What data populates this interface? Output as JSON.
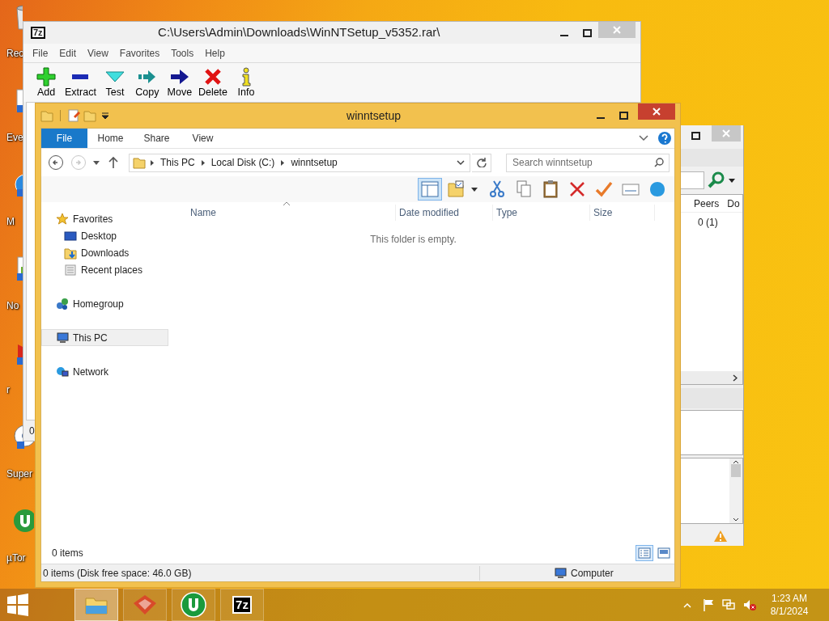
{
  "desktop_icons": [
    {
      "label": "Rec",
      "kind": "bin"
    },
    {
      "label": "Eve",
      "kind": "document"
    },
    {
      "label": "M",
      "kind": "globe"
    },
    {
      "label": "No",
      "kind": "notepad"
    },
    {
      "label": "r",
      "kind": "video"
    },
    {
      "label": "Super",
      "kind": "disc"
    },
    {
      "label": "µTor",
      "kind": "torrent"
    }
  ],
  "archive_window": {
    "logo": "7z",
    "title": "C:\\Users\\Admin\\Downloads\\WinNTSetup_v5352.rar\\",
    "menu": [
      "File",
      "Edit",
      "View",
      "Favorites",
      "Tools",
      "Help"
    ],
    "toolbar": [
      {
        "label": "Add",
        "kind": "add"
      },
      {
        "label": "Extract",
        "kind": "extract"
      },
      {
        "label": "Test",
        "kind": "test"
      },
      {
        "label": "Copy",
        "kind": "copy"
      },
      {
        "label": "Move",
        "kind": "move"
      },
      {
        "label": "Delete",
        "kind": "delete"
      },
      {
        "label": "Info",
        "kind": "info"
      }
    ],
    "status": "0"
  },
  "torrent_window": {
    "columns": [
      "Peers",
      "Do"
    ],
    "rows": [
      {
        "peers": "0 (1)"
      }
    ]
  },
  "explorer": {
    "title": "winntsetup",
    "ribbon_tabs": [
      {
        "label": "File",
        "kind": "file"
      },
      {
        "label": "Home",
        "kind": "tab"
      },
      {
        "label": "Share",
        "kind": "tab"
      },
      {
        "label": "View",
        "kind": "tab"
      }
    ],
    "nav_buttons": [
      {
        "kind": "back",
        "disabled": false
      },
      {
        "kind": "forward",
        "disabled": true
      }
    ],
    "breadcrumb": [
      "This PC",
      "Local Disk (C:)",
      "winntsetup"
    ],
    "search": {
      "placeholder": "Search winntsetup"
    },
    "preview_pane_on": true,
    "commands": [
      {
        "kind": "preview-pane"
      },
      {
        "kind": "folder-options"
      },
      {
        "kind": "cut"
      },
      {
        "kind": "copy"
      },
      {
        "kind": "paste"
      },
      {
        "kind": "delete"
      },
      {
        "kind": "check"
      },
      {
        "kind": "rename"
      },
      {
        "kind": "bubble"
      }
    ],
    "navigation": [
      {
        "label": "Favorites",
        "kind": "star",
        "selected": false,
        "children": [
          {
            "label": "Desktop",
            "kind": "desktop",
            "selected": false
          },
          {
            "label": "Downloads",
            "kind": "downloads",
            "selected": false
          },
          {
            "label": "Recent places",
            "kind": "recent",
            "selected": false
          }
        ]
      },
      {
        "label": "Homegroup",
        "kind": "homegroup",
        "selected": false
      },
      {
        "label": "This PC",
        "kind": "computer",
        "selected": true
      },
      {
        "label": "Network",
        "kind": "network",
        "selected": false
      }
    ],
    "columns": [
      {
        "label": "Name",
        "sorted": true
      },
      {
        "label": "Date modified",
        "sorted": false
      },
      {
        "label": "Type",
        "sorted": false
      },
      {
        "label": "Size",
        "sorted": false
      }
    ],
    "empty_message": "This folder is empty.",
    "item_count": "0 items",
    "views": [
      {
        "kind": "details",
        "selected": true
      },
      {
        "kind": "large-icons",
        "selected": false
      }
    ],
    "status": "0 items (Disk free space: 46.0 GB)",
    "zone": "Computer"
  },
  "taskbar": {
    "apps": [
      {
        "kind": "explorer",
        "selected": true
      },
      {
        "kind": "fox",
        "selected": false
      },
      {
        "kind": "torrent",
        "selected": false
      },
      {
        "kind": "archiver",
        "label": "7z",
        "selected": false
      }
    ],
    "time": "1:23 AM",
    "date": "8/1/2024"
  }
}
